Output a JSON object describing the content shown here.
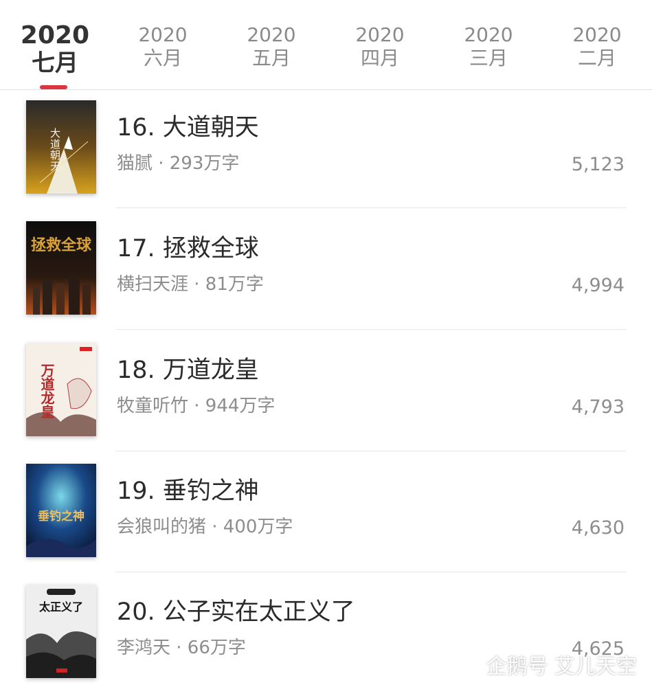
{
  "tabs": [
    {
      "year": "2020",
      "month": "七月",
      "active": true
    },
    {
      "year": "2020",
      "month": "六月"
    },
    {
      "year": "2020",
      "month": "五月"
    },
    {
      "year": "2020",
      "month": "四月"
    },
    {
      "year": "2020",
      "month": "三月"
    },
    {
      "year": "2020",
      "month": "二月"
    }
  ],
  "books": [
    {
      "title": "16. 大道朝天",
      "meta": "猫腻 · 293万字",
      "count": "5,123",
      "cover_text": "大道朝天",
      "cover_theme": "cover-dadao"
    },
    {
      "title": "17. 拯救全球",
      "meta": "横扫天涯 · 81万字",
      "count": "4,994",
      "cover_text": "拯救全球",
      "cover_theme": "cover-zhengjiu"
    },
    {
      "title": "18. 万道龙皇",
      "meta": "牧童听竹 · 944万字",
      "count": "4,793",
      "cover_text": "万道龙皇",
      "cover_theme": "cover-wandao"
    },
    {
      "title": "19. 垂钓之神",
      "meta": "会狼叫的猪 · 400万字",
      "count": "4,630",
      "cover_text": "垂钓之神",
      "cover_theme": "cover-chuidiao"
    },
    {
      "title": "20. 公子实在太正义了",
      "meta": "李鸿天 · 66万字",
      "count": "4,625",
      "cover_text": "太正义了",
      "cover_theme": "cover-gongzi"
    }
  ],
  "watermark": {
    "text": "企鹅号 艾儿天空",
    "icon": "penguin-icon"
  }
}
